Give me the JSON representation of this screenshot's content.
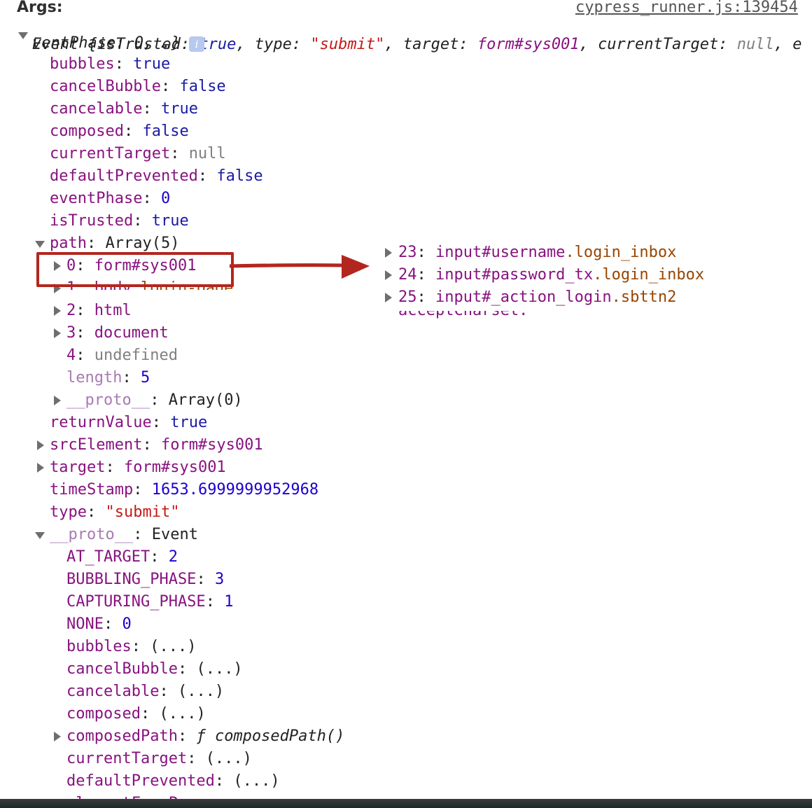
{
  "header": {
    "args_label": "Args:",
    "source_link": "cypress_runner.js:139454"
  },
  "summary": {
    "prefix": "Event {",
    "line1_parts": [
      {
        "k": "isTrusted",
        "v": "true",
        "t": "bool"
      },
      {
        "k": "type",
        "v": "\"submit\"",
        "t": "str"
      },
      {
        "k": "target",
        "v": "form#sys001",
        "t": "node"
      },
      {
        "k": "currentTarget",
        "v": "null",
        "t": "null"
      }
    ],
    "wrap_tail": "e",
    "line2": "ventPhase: 0, …}",
    "info_badge": "i"
  },
  "props": [
    {
      "key": "bubbles",
      "value": "true",
      "type": "bool"
    },
    {
      "key": "cancelBubble",
      "value": "false",
      "type": "bool"
    },
    {
      "key": "cancelable",
      "value": "true",
      "type": "bool"
    },
    {
      "key": "composed",
      "value": "false",
      "type": "bool"
    },
    {
      "key": "currentTarget",
      "value": "null",
      "type": "null"
    },
    {
      "key": "defaultPrevented",
      "value": "false",
      "type": "bool"
    },
    {
      "key": "eventPhase",
      "value": "0",
      "type": "num"
    },
    {
      "key": "isTrusted",
      "value": "true",
      "type": "bool"
    }
  ],
  "path": {
    "key": "path",
    "value": "Array(5)",
    "items": [
      {
        "index": "0",
        "tag": "form#sys001",
        "cls": ""
      },
      {
        "index": "1",
        "tag": "body",
        "cls": ".login-page"
      },
      {
        "index": "2",
        "tag": "html",
        "cls": ""
      },
      {
        "index": "3",
        "tag": "document",
        "cls": ""
      },
      {
        "index": "4",
        "tag": "undefined",
        "cls": ""
      }
    ],
    "length_key": "length",
    "length_value": "5",
    "proto_key": "__proto__",
    "proto_value": "Array(0)"
  },
  "props_after": [
    {
      "key": "returnValue",
      "value": "true",
      "type": "bool"
    },
    {
      "key": "srcElement",
      "value": "form#sys001",
      "type": "node"
    },
    {
      "key": "target",
      "value": "form#sys001",
      "type": "node"
    },
    {
      "key": "timeStamp",
      "value": "1653.6999999952968",
      "type": "num"
    },
    {
      "key": "type",
      "value": "\"submit\"",
      "type": "str"
    }
  ],
  "proto": {
    "key": "__proto__",
    "value": "Event",
    "items": [
      {
        "key": "AT_TARGET",
        "value": "2",
        "type": "num"
      },
      {
        "key": "BUBBLING_PHASE",
        "value": "3",
        "type": "num"
      },
      {
        "key": "CAPTURING_PHASE",
        "value": "1",
        "type": "num"
      },
      {
        "key": "NONE",
        "value": "0",
        "type": "num"
      },
      {
        "key": "bubbles",
        "value": "(...)",
        "type": "plain"
      },
      {
        "key": "cancelBubble",
        "value": "(...)",
        "type": "plain"
      },
      {
        "key": "cancelable",
        "value": "(...)",
        "type": "plain"
      },
      {
        "key": "composed",
        "value": "(...)",
        "type": "plain"
      },
      {
        "key": "composedPath",
        "value": "ƒ composedPath()",
        "type": "func"
      },
      {
        "key": "currentTarget",
        "value": "(...)",
        "type": "plain"
      },
      {
        "key": "defaultPrevented",
        "value": "(...)",
        "type": "plain"
      }
    ]
  },
  "inset": {
    "items": [
      {
        "index": "23",
        "tag": "input#username",
        "cls": ".login_inbox"
      },
      {
        "index": "24",
        "tag": "input#password_tx",
        "cls": ".login_inbox"
      },
      {
        "index": "25",
        "tag": "input#_action_login",
        "cls": ".sbttn2"
      }
    ],
    "cut_line": "acceptCharset: \"\""
  },
  "colors": {
    "annotation": "#b3261e",
    "key": "#881280",
    "bool": "#1a1aa6",
    "string": "#c41a16"
  }
}
